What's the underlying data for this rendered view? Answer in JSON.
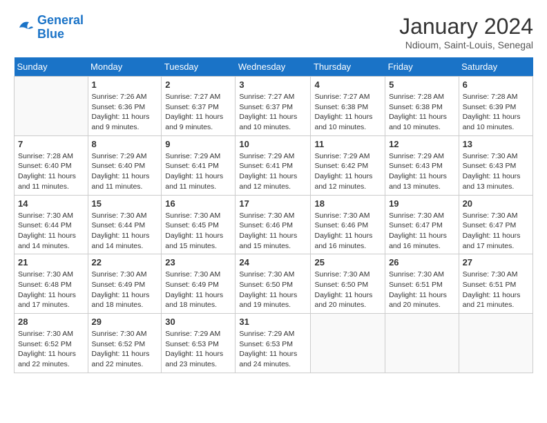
{
  "header": {
    "logo_general": "General",
    "logo_blue": "Blue",
    "month_title": "January 2024",
    "subtitle": "Ndioum, Saint-Louis, Senegal"
  },
  "days_of_week": [
    "Sunday",
    "Monday",
    "Tuesday",
    "Wednesday",
    "Thursday",
    "Friday",
    "Saturday"
  ],
  "weeks": [
    [
      {
        "day": "",
        "info": ""
      },
      {
        "day": "1",
        "info": "Sunrise: 7:26 AM\nSunset: 6:36 PM\nDaylight: 11 hours and 9 minutes."
      },
      {
        "day": "2",
        "info": "Sunrise: 7:27 AM\nSunset: 6:37 PM\nDaylight: 11 hours and 9 minutes."
      },
      {
        "day": "3",
        "info": "Sunrise: 7:27 AM\nSunset: 6:37 PM\nDaylight: 11 hours and 10 minutes."
      },
      {
        "day": "4",
        "info": "Sunrise: 7:27 AM\nSunset: 6:38 PM\nDaylight: 11 hours and 10 minutes."
      },
      {
        "day": "5",
        "info": "Sunrise: 7:28 AM\nSunset: 6:38 PM\nDaylight: 11 hours and 10 minutes."
      },
      {
        "day": "6",
        "info": "Sunrise: 7:28 AM\nSunset: 6:39 PM\nDaylight: 11 hours and 10 minutes."
      }
    ],
    [
      {
        "day": "7",
        "info": "Sunrise: 7:28 AM\nSunset: 6:40 PM\nDaylight: 11 hours and 11 minutes."
      },
      {
        "day": "8",
        "info": "Sunrise: 7:29 AM\nSunset: 6:40 PM\nDaylight: 11 hours and 11 minutes."
      },
      {
        "day": "9",
        "info": "Sunrise: 7:29 AM\nSunset: 6:41 PM\nDaylight: 11 hours and 11 minutes."
      },
      {
        "day": "10",
        "info": "Sunrise: 7:29 AM\nSunset: 6:41 PM\nDaylight: 11 hours and 12 minutes."
      },
      {
        "day": "11",
        "info": "Sunrise: 7:29 AM\nSunset: 6:42 PM\nDaylight: 11 hours and 12 minutes."
      },
      {
        "day": "12",
        "info": "Sunrise: 7:29 AM\nSunset: 6:43 PM\nDaylight: 11 hours and 13 minutes."
      },
      {
        "day": "13",
        "info": "Sunrise: 7:30 AM\nSunset: 6:43 PM\nDaylight: 11 hours and 13 minutes."
      }
    ],
    [
      {
        "day": "14",
        "info": "Sunrise: 7:30 AM\nSunset: 6:44 PM\nDaylight: 11 hours and 14 minutes."
      },
      {
        "day": "15",
        "info": "Sunrise: 7:30 AM\nSunset: 6:44 PM\nDaylight: 11 hours and 14 minutes."
      },
      {
        "day": "16",
        "info": "Sunrise: 7:30 AM\nSunset: 6:45 PM\nDaylight: 11 hours and 15 minutes."
      },
      {
        "day": "17",
        "info": "Sunrise: 7:30 AM\nSunset: 6:46 PM\nDaylight: 11 hours and 15 minutes."
      },
      {
        "day": "18",
        "info": "Sunrise: 7:30 AM\nSunset: 6:46 PM\nDaylight: 11 hours and 16 minutes."
      },
      {
        "day": "19",
        "info": "Sunrise: 7:30 AM\nSunset: 6:47 PM\nDaylight: 11 hours and 16 minutes."
      },
      {
        "day": "20",
        "info": "Sunrise: 7:30 AM\nSunset: 6:47 PM\nDaylight: 11 hours and 17 minutes."
      }
    ],
    [
      {
        "day": "21",
        "info": "Sunrise: 7:30 AM\nSunset: 6:48 PM\nDaylight: 11 hours and 17 minutes."
      },
      {
        "day": "22",
        "info": "Sunrise: 7:30 AM\nSunset: 6:49 PM\nDaylight: 11 hours and 18 minutes."
      },
      {
        "day": "23",
        "info": "Sunrise: 7:30 AM\nSunset: 6:49 PM\nDaylight: 11 hours and 18 minutes."
      },
      {
        "day": "24",
        "info": "Sunrise: 7:30 AM\nSunset: 6:50 PM\nDaylight: 11 hours and 19 minutes."
      },
      {
        "day": "25",
        "info": "Sunrise: 7:30 AM\nSunset: 6:50 PM\nDaylight: 11 hours and 20 minutes."
      },
      {
        "day": "26",
        "info": "Sunrise: 7:30 AM\nSunset: 6:51 PM\nDaylight: 11 hours and 20 minutes."
      },
      {
        "day": "27",
        "info": "Sunrise: 7:30 AM\nSunset: 6:51 PM\nDaylight: 11 hours and 21 minutes."
      }
    ],
    [
      {
        "day": "28",
        "info": "Sunrise: 7:30 AM\nSunset: 6:52 PM\nDaylight: 11 hours and 22 minutes."
      },
      {
        "day": "29",
        "info": "Sunrise: 7:30 AM\nSunset: 6:52 PM\nDaylight: 11 hours and 22 minutes."
      },
      {
        "day": "30",
        "info": "Sunrise: 7:29 AM\nSunset: 6:53 PM\nDaylight: 11 hours and 23 minutes."
      },
      {
        "day": "31",
        "info": "Sunrise: 7:29 AM\nSunset: 6:53 PM\nDaylight: 11 hours and 24 minutes."
      },
      {
        "day": "",
        "info": ""
      },
      {
        "day": "",
        "info": ""
      },
      {
        "day": "",
        "info": ""
      }
    ]
  ]
}
